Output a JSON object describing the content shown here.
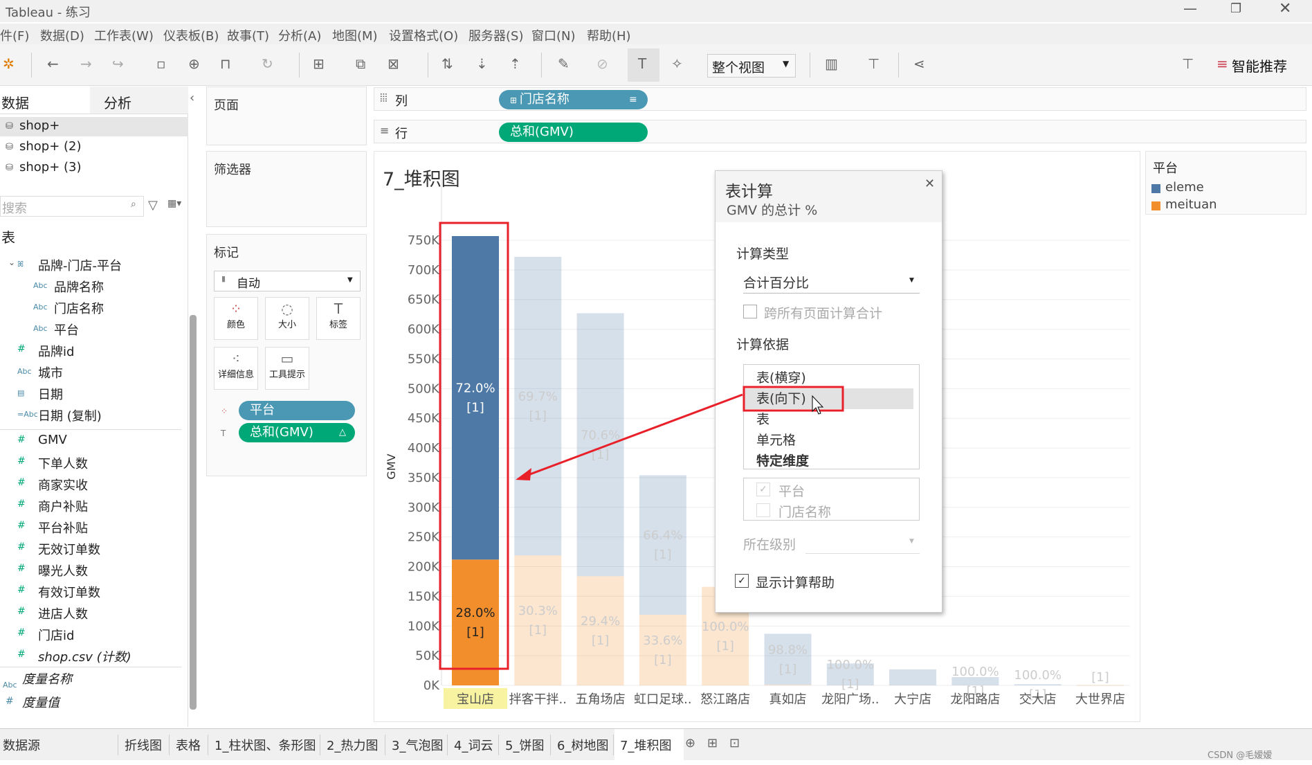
{
  "window": {
    "title": "Tableau - 练习"
  },
  "menu": [
    "件(F)",
    "数据(D)",
    "工作表(W)",
    "仪表板(B)",
    "故事(T)",
    "分析(A)",
    "地图(M)",
    "设置格式(O)",
    "服务器(S)",
    "窗口(N)",
    "帮助(H)"
  ],
  "toolbar": {
    "view_select": "整个视图",
    "recommend": "智能推荐"
  },
  "left_pane": {
    "tabs": [
      "数据",
      "分析"
    ],
    "sources": [
      "shop+",
      "shop+ (2)",
      "shop+ (3)"
    ],
    "search_placeholder": "搜索",
    "section": "表",
    "fields": [
      {
        "icon": "hierarchy",
        "label": "品牌-门店-平台",
        "indent": 0
      },
      {
        "icon": "Abc",
        "label": "品牌名称",
        "indent": 1
      },
      {
        "icon": "Abc",
        "label": "门店名称",
        "indent": 1
      },
      {
        "icon": "Abc",
        "label": "平台",
        "indent": 1
      },
      {
        "icon": "#",
        "label": "品牌id",
        "indent": 0
      },
      {
        "icon": "Abc",
        "label": "城市",
        "indent": 0
      },
      {
        "icon": "date",
        "label": "日期",
        "indent": 0
      },
      {
        "icon": "=Abc",
        "label": "日期 (复制)",
        "indent": 0
      },
      {
        "icon": "#",
        "label": "GMV",
        "indent": 0
      },
      {
        "icon": "#",
        "label": "下单人数",
        "indent": 0
      },
      {
        "icon": "#",
        "label": "商家实收",
        "indent": 0
      },
      {
        "icon": "#",
        "label": "商户补贴",
        "indent": 0
      },
      {
        "icon": "#",
        "label": "平台补贴",
        "indent": 0
      },
      {
        "icon": "#",
        "label": "无效订单数",
        "indent": 0
      },
      {
        "icon": "#",
        "label": "曝光人数",
        "indent": 0
      },
      {
        "icon": "#",
        "label": "有效订单数",
        "indent": 0
      },
      {
        "icon": "#",
        "label": "进店人数",
        "indent": 0
      },
      {
        "icon": "#",
        "label": "门店id",
        "indent": 0
      },
      {
        "icon": "#",
        "label": "shop.csv (计数)",
        "indent": 0
      }
    ],
    "measure_names": "度量名称",
    "measure_values": "度量值"
  },
  "cards": {
    "pages": "页面",
    "filters": "筛选器",
    "marks": "标记",
    "mark_type": "自动",
    "mark_buttons": [
      "颜色",
      "大小",
      "标签",
      "详细信息",
      "工具提示"
    ],
    "mark_pills": [
      "平台",
      "总和(GMV)"
    ]
  },
  "shelves": {
    "columns_label": "列",
    "columns_pill": "门店名称",
    "rows_label": "行",
    "rows_pill": "总和(GMV)"
  },
  "sheet_title": "7_堆积图",
  "colors": {
    "eleme": "#4e79a7",
    "meituan": "#f28e2b",
    "green_pill": "#00a878",
    "blue_pill": "#4b98b4",
    "annotation": "#e8202a"
  },
  "legend": {
    "title": "平台",
    "items": [
      {
        "label": "eleme",
        "color": "#4e79a7"
      },
      {
        "label": "meituan",
        "color": "#f28e2b"
      }
    ]
  },
  "chart_data": {
    "type": "bar",
    "stacked": true,
    "ylabel": "GMV",
    "yticks": [
      "0K",
      "50K",
      "100K",
      "150K",
      "200K",
      "250K",
      "300K",
      "350K",
      "400K",
      "450K",
      "500K",
      "550K",
      "600K",
      "650K",
      "700K",
      "750K"
    ],
    "ylim": [
      0,
      780000
    ],
    "categories": [
      "宝山店",
      "拌客干拌..",
      "五角场店",
      "虹口足球..",
      "怒江路店",
      "真如店",
      "龙阳广场..",
      "大宁店",
      "龙阳路店",
      "交大店",
      "大世界店"
    ],
    "highlighted": "宝山店",
    "series": [
      {
        "name": "eleme",
        "values": [
          545000,
          503000,
          443000,
          235000,
          0,
          86000,
          37000,
          27000,
          14000,
          2000,
          0
        ],
        "labels": [
          "72.0%",
          "69.7%",
          "70.6%",
          "66.4%",
          "",
          "98.8%",
          "100.0%",
          "",
          "100.0%",
          "100.0%",
          ""
        ]
      },
      {
        "name": "meituan",
        "values": [
          212000,
          219000,
          184000,
          119000,
          166000,
          1000,
          0,
          0,
          0,
          0,
          500
        ],
        "labels": [
          "28.0%",
          "30.3%",
          "29.4%",
          "33.6%",
          "100.0%",
          "",
          "",
          "",
          "",
          "",
          ""
        ]
      }
    ],
    "sublabel": "[1]"
  },
  "dialog": {
    "title": "表计算",
    "subtitle": "GMV 的总计 %",
    "calc_type_label": "计算类型",
    "calc_type": "合计百分比",
    "across_pages": "跨所有页面计算合计",
    "compute_using_label": "计算依据",
    "compute_options": [
      "表(横穿)",
      "表(向下)",
      "表",
      "单元格",
      "特定维度"
    ],
    "selected_option": "表(向下)",
    "dimensions": [
      {
        "label": "平台",
        "checked": true
      },
      {
        "label": "门店名称",
        "checked": false
      }
    ],
    "level_label": "所在级别",
    "show_help": "显示计算帮助"
  },
  "tabs": {
    "datasource": "数据源",
    "sheets": [
      "折线图",
      "表格",
      "1_柱状图、条形图",
      "2_热力图",
      "3_气泡图",
      "4_词云",
      "5_饼图",
      "6_树地图",
      "7_堆积图"
    ],
    "active": "7_堆积图"
  },
  "watermark": "CSDN @毛嫒嫒"
}
